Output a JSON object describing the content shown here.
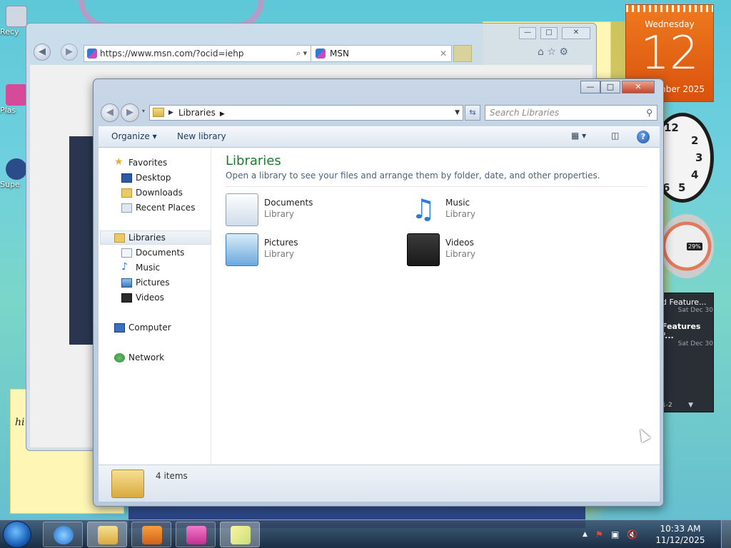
{
  "desktop": {
    "icons": [
      {
        "label": "Recy",
        "color": "#cfd8e2"
      },
      {
        "label": "Plas",
        "color": "#d64a9a"
      },
      {
        "label": "Supe",
        "color": "#2a4d8a"
      }
    ],
    "sticky_text": "hi"
  },
  "ie": {
    "url": "https://www.msn.com/?ocid=iehp",
    "tab_title": "MSN",
    "tab_close": "✕"
  },
  "calendar": {
    "weekday": "Wednesday",
    "day": "12",
    "month_year": "mber 2025"
  },
  "clock": {
    "numbers": [
      "12",
      "2",
      "3",
      "4",
      "5",
      "6"
    ]
  },
  "meter": {
    "percent": "29%"
  },
  "feeds": {
    "items": [
      {
        "title": "d Feature...",
        "date": "Sat Dec 30"
      },
      {
        "title": "Features f...",
        "date": "Sat Dec 30"
      }
    ],
    "pager": "1-2"
  },
  "explorer": {
    "breadcrumb": "Libraries",
    "search_placeholder": "Search Libraries",
    "toolbar": {
      "organize": "Organize",
      "new_library": "New library"
    },
    "nav": {
      "favorites": "Favorites",
      "favorites_items": [
        "Desktop",
        "Downloads",
        "Recent Places"
      ],
      "libraries": "Libraries",
      "libraries_items": [
        "Documents",
        "Music",
        "Pictures",
        "Videos"
      ],
      "computer": "Computer",
      "network": "Network"
    },
    "main": {
      "title": "Libraries",
      "subtitle": "Open a library to see your files and arrange them by folder, date, and other properties.",
      "tiles": [
        {
          "name": "Documents",
          "type": "Library",
          "icon": "documents-icon"
        },
        {
          "name": "Music",
          "type": "Library",
          "icon": "music-icon"
        },
        {
          "name": "Pictures",
          "type": "Library",
          "icon": "pictures-icon"
        },
        {
          "name": "Videos",
          "type": "Library",
          "icon": "videos-icon"
        }
      ]
    },
    "status": {
      "count": "4 items"
    }
  },
  "taskbar": {
    "apps": [
      "internet-explorer",
      "windows-explorer",
      "media-player",
      "paint-app",
      "sticky-notes"
    ],
    "time": "10:33 AM",
    "date": "11/12/2025"
  }
}
